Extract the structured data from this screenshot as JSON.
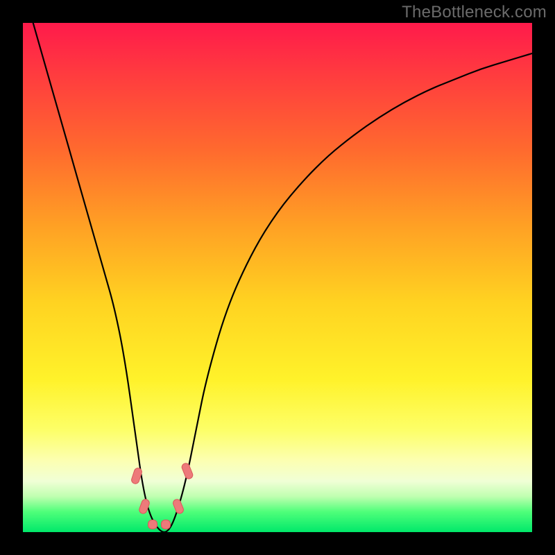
{
  "watermark": "TheBottleneck.com",
  "colors": {
    "frame": "#000000",
    "gradient_top": "#ff1a4b",
    "gradient_bottom": "#00e86a",
    "curve": "#000000",
    "marker_fill": "#ed7a7a",
    "marker_stroke": "#d85a5a"
  },
  "chart_data": {
    "type": "line",
    "title": "",
    "xlabel": "",
    "ylabel": "",
    "xlim": [
      0,
      100
    ],
    "ylim": [
      0,
      100
    ],
    "grid": false,
    "legend": false,
    "series": [
      {
        "name": "curve",
        "x": [
          2,
          4,
          6,
          8,
          10,
          12,
          14,
          16,
          18,
          20,
          22,
          23.5,
          25,
          27,
          28.5,
          30,
          32,
          34,
          36,
          40,
          45,
          50,
          55,
          60,
          65,
          70,
          75,
          80,
          85,
          90,
          95,
          100
        ],
        "values": [
          100,
          93,
          86,
          79,
          72,
          65,
          58,
          51,
          44,
          34,
          20,
          9,
          3,
          0,
          0,
          3,
          10,
          20,
          30,
          44,
          55,
          63,
          69,
          74,
          78,
          81.5,
          84.5,
          87,
          89,
          91,
          92.5,
          94
        ]
      }
    ],
    "markers": [
      {
        "x": 22.3,
        "y": 11,
        "w": 12,
        "h": 24,
        "rot": 18
      },
      {
        "x": 23.8,
        "y": 5,
        "w": 12,
        "h": 22,
        "rot": 20
      },
      {
        "x": 25.5,
        "y": 1.5,
        "w": 14,
        "h": 14,
        "rot": 0
      },
      {
        "x": 28.0,
        "y": 1.5,
        "w": 14,
        "h": 14,
        "rot": 0
      },
      {
        "x": 30.5,
        "y": 5,
        "w": 12,
        "h": 22,
        "rot": -22
      },
      {
        "x": 32.3,
        "y": 12,
        "w": 12,
        "h": 24,
        "rot": -22
      }
    ]
  }
}
